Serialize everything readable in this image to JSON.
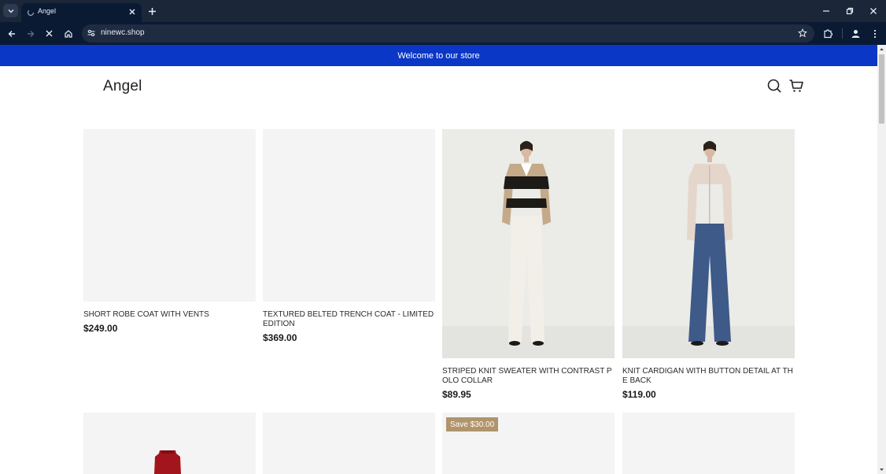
{
  "browser": {
    "tab_title": "Angel",
    "url": "ninewc.shop"
  },
  "store": {
    "announcement": "Welcome to our store",
    "logo_text": "Angel"
  },
  "products": [
    {
      "title": "SHORT ROBE COAT WITH VENTS",
      "price": "$249.00",
      "image": "placeholder"
    },
    {
      "title": "TEXTURED BELTED TRENCH COAT - LIMITED EDITION",
      "price": "$369.00",
      "image": "placeholder"
    },
    {
      "title": "STRIPED KNIT SWEATER WITH CONTRAST POLO COLLAR",
      "price": "$89.95",
      "image": "model-striped-sweater"
    },
    {
      "title": "KNIT CARDIGAN WITH BUTTON DETAIL AT THE BACK",
      "price": "$119.00",
      "image": "model-cardigan"
    }
  ],
  "second_row": [
    {
      "image": "red-item",
      "badge": ""
    },
    {
      "image": "placeholder",
      "badge": ""
    },
    {
      "image": "placeholder",
      "badge": "Save $30.00"
    },
    {
      "image": "placeholder",
      "badge": ""
    }
  ],
  "colors": {
    "announcement_bg": "#0b37c6",
    "badge_bg": "#b0946b",
    "chrome_bg": "#0b1a33"
  }
}
